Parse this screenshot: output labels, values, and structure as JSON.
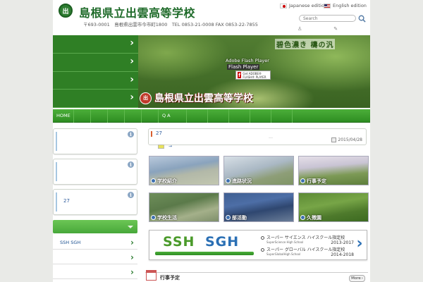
{
  "header": {
    "logo_glyph": "出",
    "school_name": "島根県立出雲高等学校",
    "address": "〒693-0001　島根県出雲市今市町1800　TEL 0853-21-0008 FAX 0853-22-7855",
    "lang_ja": "Japanese edition",
    "lang_en": "English edition",
    "search_placeholder": "Search",
    "search_icon": "search-icon"
  },
  "hero": {
    "menu_count": 4,
    "tagline": "碧色濃き 檮の汎",
    "flash_title": "Adobe Flash Player",
    "flash_sub": "Flash Player",
    "flash_get": "Get ADOBE® FLASH® PLAYER",
    "banner_seal": "出",
    "banner_text": "島根県立出雲高等学校"
  },
  "nav": {
    "items": [
      "HOME",
      "",
      "",
      "",
      "",
      "",
      "Q A",
      "",
      "",
      "",
      "",
      ""
    ]
  },
  "sidebar": {
    "box3_count": "27",
    "links": [
      "SSH SGH",
      "",
      ""
    ]
  },
  "news": {
    "count": "27",
    "dots": "…",
    "date": "2015/04/28",
    "arrow": "→"
  },
  "tiles": [
    {
      "label": "学校紹介",
      "color": "#6e8fb0"
    },
    {
      "label": "進路状況",
      "color": "#8fa7b8"
    },
    {
      "label": "行事予定",
      "color": "#8aa66e"
    },
    {
      "label": "学校生活",
      "color": "#5a7f55"
    },
    {
      "label": "部活動",
      "color": "#4a6f9e"
    },
    {
      "label": "久徴園",
      "color": "#5f8f3e"
    }
  ],
  "ssh": {
    "ssh": "SSH",
    "sgh": "SGH",
    "item1_ja": "スーパー サイエンス ハイスクール指定校",
    "item1_en": "SuperScience High School",
    "item1_years": "2013-2017",
    "item2_ja": "スーパー グローバル ハイスクール指定校",
    "item2_en": "SuperGlobalHigh School",
    "item2_years": "2014-2018",
    "next": "›"
  },
  "events": {
    "title": "行事予定",
    "more": "More"
  }
}
